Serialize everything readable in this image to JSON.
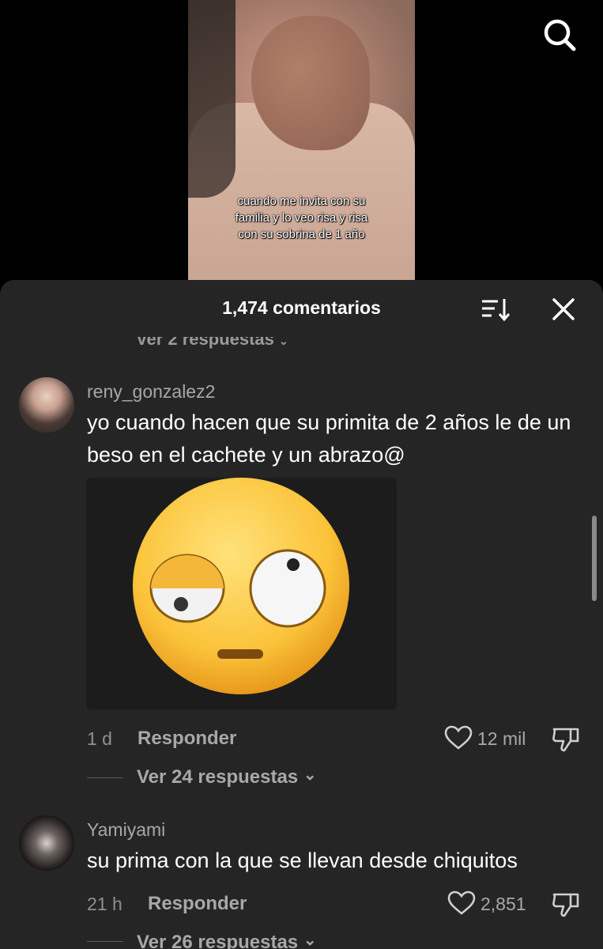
{
  "video": {
    "caption_lines": [
      "cuando me invita con su",
      "familia y lo veo risa y risa",
      "con su sobrina de 1 año"
    ]
  },
  "icons": {
    "search": "search-icon",
    "sort": "sort-icon",
    "close": "close-icon",
    "like": "heart-icon",
    "dislike": "dislike-icon",
    "expand": "chevron-down-icon"
  },
  "sheet": {
    "title": "1,474 comentarios",
    "partial_replies": "Ver 2 respuestas"
  },
  "comments": [
    {
      "username": "reny_gonzalez2",
      "text": "yo cuando hacen que su primita de 2 años le de un beso en el cachete y un abrazo@",
      "sticker": "eye-roll-emoji",
      "time": "1 d",
      "reply": "Responder",
      "likes": "12 mil",
      "view_replies": "Ver 24 respuestas"
    },
    {
      "username": "Yamiyami",
      "text": "su prima con la que se llevan desde chiquitos",
      "time": "21 h",
      "reply": "Responder",
      "likes": "2,851",
      "view_replies": "Ver 26 respuestas"
    }
  ],
  "colors": {
    "sheet_bg": "#252525",
    "text": "#ffffff",
    "muted": "#a8a8a8"
  }
}
